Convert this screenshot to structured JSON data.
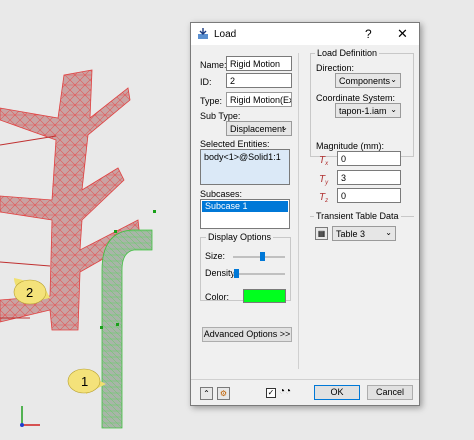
{
  "dialog": {
    "title": "Load",
    "help": "?",
    "close": "✕",
    "name_label": "Name:",
    "name_value": "Rigid Motion",
    "id_label": "ID:",
    "id_value": "2",
    "type_label": "Type:",
    "type_value": "Rigid Motion(Exp",
    "subtype_label": "Sub Type:",
    "subtype_value": "Displacement",
    "selected_entities_label": "Selected Entities:",
    "selected_entities_value": "body<1>@Solid1:1",
    "subcases_label": "Subcases:",
    "subcases": [
      "Subcase 1"
    ],
    "display_options": {
      "title": "Display Options",
      "size_label": "Size:",
      "size_level": 0.55,
      "density_label": "Density:",
      "density_level": 0.05,
      "color_label": "Color:",
      "color_value": "#00ff1e"
    },
    "advanced_button": "Advanced Options >>",
    "load_definition": {
      "title": "Load Definition",
      "direction_label": "Direction:",
      "direction_value": "Components",
      "coord_label": "Coordinate System:",
      "coord_value": "tapon-1.iam",
      "magnitude_label": "Magnitude (mm):",
      "tx_symbol": "T",
      "tx_sub": "x",
      "tx_value": "0",
      "ty_symbol": "T",
      "ty_sub": "y",
      "ty_value": "3",
      "tz_symbol": "T",
      "tz_sub": "z",
      "tz_value": "0"
    },
    "transient": {
      "title": "Transient Table Data",
      "table_value": "Table 3"
    },
    "ok_label": "OK",
    "cancel_label": "Cancel"
  },
  "viewport": {
    "callout_1": "1",
    "callout_2": "2",
    "axis_x": "X",
    "axis_y": "Y",
    "mesh_color_red": "#e36a6a",
    "mesh_color_green": "#7bdc7b"
  }
}
